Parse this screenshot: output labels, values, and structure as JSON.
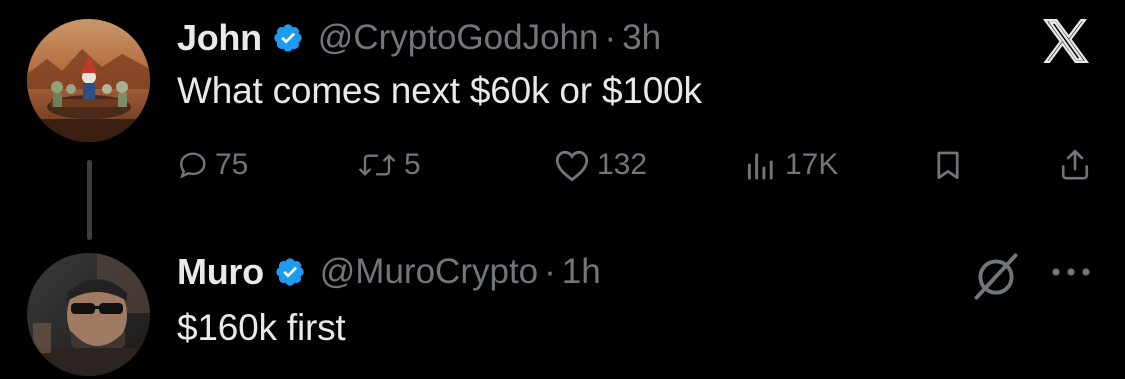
{
  "tweets": [
    {
      "name": "John",
      "handle": "@CryptoGodJohn",
      "separator": "·",
      "time": "3h",
      "text": "What comes next $60k or $100k",
      "actions": {
        "replies": "75",
        "reposts": "5",
        "likes": "132",
        "views": "17K"
      },
      "icons": [
        "verified-icon",
        "reply-icon",
        "repost-icon",
        "like-icon",
        "views-icon",
        "bookmark-icon",
        "share-icon",
        "x-logo-icon"
      ]
    },
    {
      "name": "Muro",
      "handle": "@MuroCrypto",
      "separator": "·",
      "time": "1h",
      "text": "$160k first",
      "icons": [
        "verified-icon",
        "grok-icon",
        "more-icon"
      ]
    }
  ],
  "colors": {
    "background": "#000000",
    "primary_text": "#e7e9ea",
    "secondary_text": "#71767b",
    "verified_blue": "#1d9bf0",
    "thread_line": "#3b3f44"
  }
}
